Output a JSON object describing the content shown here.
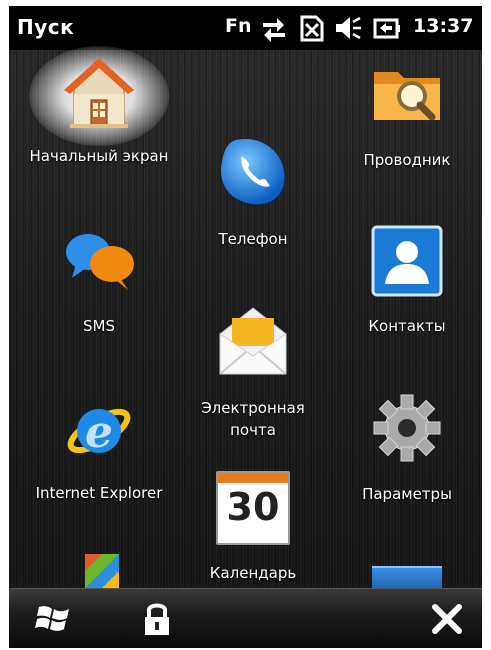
{
  "status": {
    "title": "Пуск",
    "fn": "Fn",
    "time": "13:37",
    "icons": [
      "data-connection-icon",
      "no-sim-icon",
      "speaker-muted-icon",
      "battery-charging-icon"
    ]
  },
  "tiles": [
    {
      "label": "Начальный экран",
      "icon": "home-icon"
    },
    {
      "label": "Телефон",
      "icon": "phone-icon"
    },
    {
      "label": "Проводник",
      "icon": "explorer-folder-icon"
    },
    {
      "label": "SMS",
      "icon": "sms-bubbles-icon"
    },
    {
      "label": "Контакты",
      "icon": "contacts-icon"
    },
    {
      "label": "Электронная",
      "label2": "почта",
      "icon": "mail-envelope-icon"
    },
    {
      "label": "Internet Explorer",
      "icon": "internet-explorer-icon"
    },
    {
      "label": "Параметры",
      "icon": "gear-icon"
    },
    {
      "label": "30",
      "caption": "Календарь",
      "icon": "calendar-icon"
    }
  ],
  "bottombar": {
    "icons": [
      "windows-start-icon",
      "lock-icon",
      "close-icon"
    ]
  },
  "colors": {
    "statusbar": "#000000",
    "background": "#1f1f1f",
    "text": "#ffffff"
  }
}
